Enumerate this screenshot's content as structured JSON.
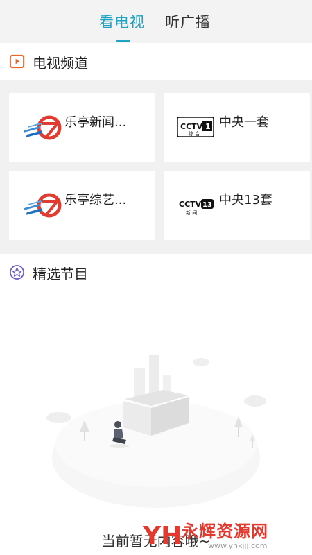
{
  "tabs": [
    {
      "label": "看电视",
      "active": true
    },
    {
      "label": "听广播",
      "active": false
    }
  ],
  "tv_section": {
    "title": "电视频道",
    "channels": [
      {
        "name": "乐亭新闻...",
        "logo": "leting-tv-logo"
      },
      {
        "name": "中央一套",
        "logo": "cctv1-logo",
        "logo_text": "CCTV",
        "logo_num": "1",
        "logo_sub": "综 合"
      },
      {
        "name": "乐亭综艺...",
        "logo": "leting-tv-logo"
      },
      {
        "name": "中央13套",
        "logo": "cctv13-logo",
        "logo_text": "CCTV",
        "logo_num": "13",
        "logo_sub": "新 闻"
      }
    ]
  },
  "featured_section": {
    "title": "精选节目",
    "empty_text": "当前暂无内容哦~"
  },
  "watermark": {
    "logo_text": "YH",
    "text": "永辉资源网",
    "url": "www.yhkjjj.com"
  },
  "colors": {
    "accent": "#1fa3c3",
    "tv_icon": "#e8672a",
    "feat_icon": "#6a5acd",
    "watermark": "#e23a2f"
  }
}
